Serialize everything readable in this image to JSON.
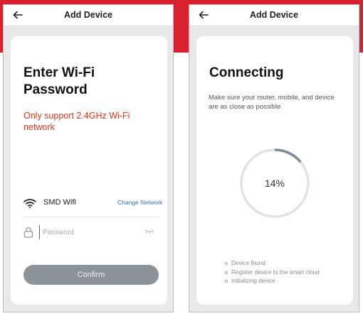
{
  "left_screen": {
    "topbar_title": "Add Device",
    "heading_line1": "Enter Wi-Fi",
    "heading_line2": "Password",
    "warning": "Only support 2.4GHz Wi-Fi network",
    "wifi_name": "SMD Wifi",
    "change_network": "Change Network",
    "password_placeholder": "Password",
    "password_value": "",
    "confirm_label": "Confirm",
    "icons": [
      "back-arrow-icon",
      "wifi-icon",
      "lock-icon",
      "eye-hidden-icon"
    ]
  },
  "right_screen": {
    "topbar_title": "Add Device",
    "heading": "Connecting",
    "subtext": "Make sure your router, mobile, and device are as close as possible",
    "progress_percent": 14,
    "progress_label": "14%",
    "steps": [
      "Device found",
      "Register device to the smart cloud",
      "Initializing device"
    ]
  },
  "colors": {
    "brand_red": "#d9202e",
    "warning_text": "#e0341c",
    "link_blue": "#3a6fb0",
    "button_gray": "#8c949a",
    "progress_track": "#e3e3e3",
    "progress_fill": "#7f8a91"
  }
}
